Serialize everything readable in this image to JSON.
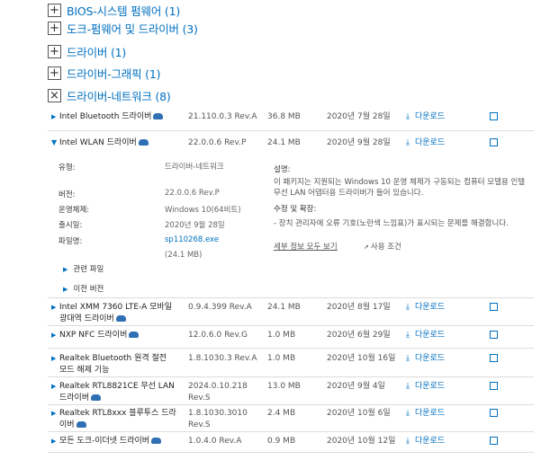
{
  "categories": [
    {
      "toggle": "+",
      "label": "BIOS-시스템 펌웨어 (1)"
    },
    {
      "toggle": "+",
      "label": "도크-펌웨어 및 드라이버 (3)"
    },
    {
      "toggle": "+",
      "label": "드라이버 (1)"
    },
    {
      "toggle": "+",
      "label": "드라이버-그래픽 (1)"
    },
    {
      "toggle": "×",
      "label": "드라이버-네트워크 (8)"
    }
  ],
  "download_label": "다운로드",
  "drivers": [
    {
      "name": "Intel Bluetooth 드라이버",
      "version": "21.110.0.3 Rev.A",
      "size": "36.8 MB",
      "date": "2020년 7월 28일"
    },
    {
      "name": "Intel WLAN 드라이버",
      "version": "22.0.0.6 Rev.P",
      "size": "24.1 MB",
      "date": "2020년 9월 28일"
    },
    {
      "name": "Intel XMM 7360 LTE-A 모바일 광대역 드라이버",
      "version": "0.9.4.399 Rev.A",
      "size": "24.1 MB",
      "date": "2020년 8월 17일"
    },
    {
      "name": "NXP NFC 드라이버",
      "version": "12.0.6.0 Rev.G",
      "size": "1.0 MB",
      "date": "2020년 6월 29일"
    },
    {
      "name": "Realtek Bluetooth 원격 절전 모드 해제 기능",
      "version": "1.8.1030.3 Rev.A",
      "size": "1.0 MB",
      "date": "2020년 10월 16일"
    },
    {
      "name": "Realtek RTL8821CE 무선 LAN 드라이버",
      "version": "2024.0.10.218 Rev.S",
      "size": "13.0 MB",
      "date": "2020년 9월 4일"
    },
    {
      "name": "Realtek RTL8xxx 블루투스 드라이버",
      "version": "1.8.1030.3010 Rev.S",
      "size": "2.4 MB",
      "date": "2020년 10월 6일"
    },
    {
      "name": "모든 도크-이더넷 드라이버",
      "version": "1.0.4.0 Rev.A",
      "size": "0.9 MB",
      "date": "2020년 10월 12일"
    }
  ],
  "detail": {
    "type_label": "유형:",
    "type_value": "드라이버-네트워크",
    "version_label": "버전:",
    "version_value": "22.0.0.6 Rev.P",
    "os_label": "운영체제:",
    "os_value": "Windows 10(64비트)",
    "release_label": "출시일:",
    "release_value": "2020년 9월 28일",
    "file_label": "파일명:",
    "file_value": "sp110268.exe",
    "file_size": "(24.1 MB)",
    "desc_heading": "설명:",
    "desc_text": "이 패키지는 지원되는 Windows 10 운영 체제가 구동되는 컴퓨터 모델용 인텔 무선 LAN 어댑터용 드라이버가 들어 있습니다.",
    "fix_heading": "수정 및 확장:",
    "fix_text": "- 장치 관리자에 오류 기호(노란색 느낌표)가 표시되는 문제를 해결합니다.",
    "more_link": "세부 정보 모두 보기",
    "terms_link": "사용 조건",
    "related_files": "관련 파일",
    "prev_versions": "이전 버전"
  }
}
